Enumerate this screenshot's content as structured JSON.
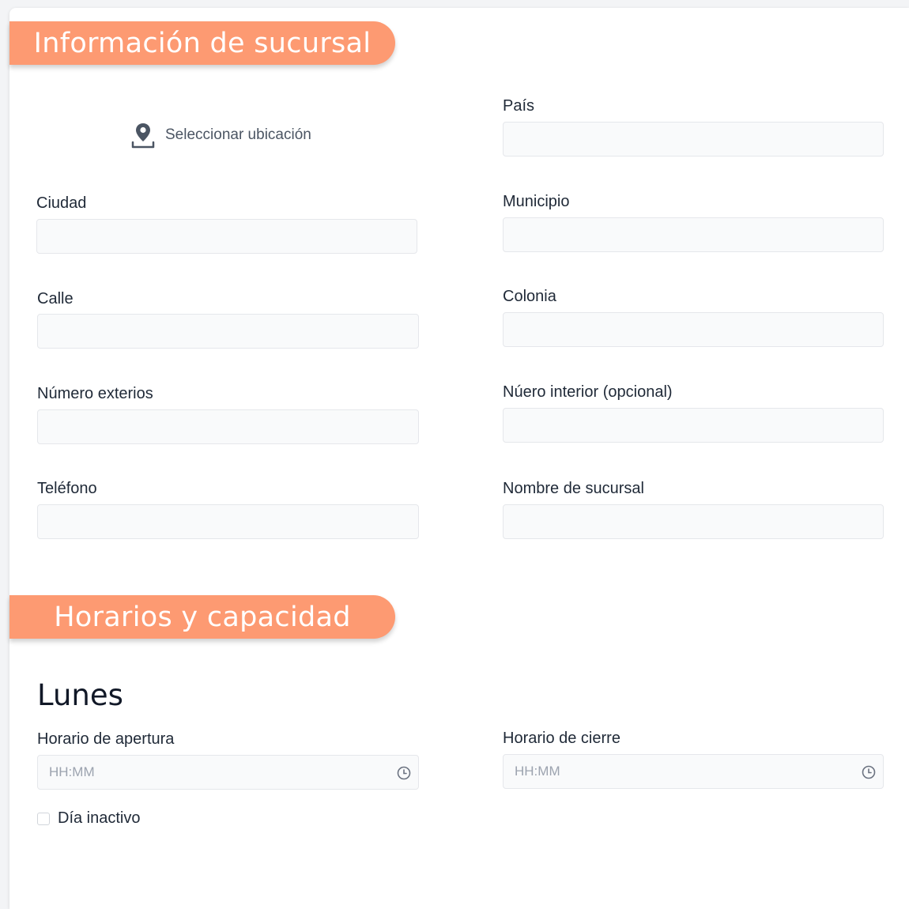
{
  "sections": {
    "branch_info_title": "Información de sucursal",
    "hours_title": "Horarios y capacidad"
  },
  "location": {
    "button_label": "Seleccionar ubicación",
    "icon": "map-pin-icon"
  },
  "fields": {
    "pais": {
      "label": "País",
      "value": ""
    },
    "ciudad": {
      "label": "Ciudad",
      "value": ""
    },
    "municipio": {
      "label": "Municipio",
      "value": ""
    },
    "calle": {
      "label": "Calle",
      "value": ""
    },
    "colonia": {
      "label": "Colonia",
      "value": ""
    },
    "numero_exterior": {
      "label": "Número exterios",
      "value": ""
    },
    "numero_interior": {
      "label": "Núero interior (opcional)",
      "value": ""
    },
    "telefono": {
      "label": "Teléfono",
      "value": ""
    },
    "nombre_sucursal": {
      "label": "Nombre de sucursal",
      "value": ""
    }
  },
  "schedule": {
    "day": "Lunes",
    "opening": {
      "label": "Horario de apertura",
      "placeholder": "HH:MM",
      "icon": "clock-icon"
    },
    "closing": {
      "label": "Horario de cierre",
      "placeholder": "HH:MM",
      "icon": "clock-icon"
    },
    "inactive_label": "Día inactivo",
    "inactive_checked": false
  },
  "colors": {
    "ribbon": "#fd9a72",
    "field_bg": "#f9fafb",
    "field_border": "#e5e7eb"
  }
}
